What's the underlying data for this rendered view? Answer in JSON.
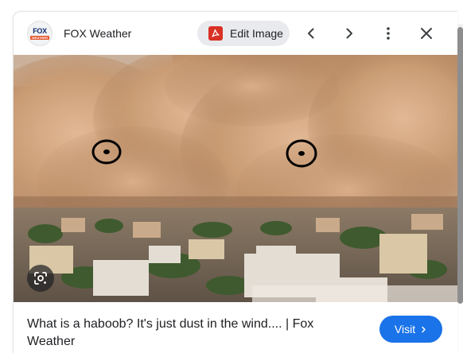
{
  "header": {
    "source_logo_top": "FOX",
    "source_logo_bottom": "WEATHER",
    "source_name": "FOX Weather",
    "edit_button_label": "Edit Image"
  },
  "icons": {
    "edit": "pdf-icon",
    "previous": "chevron-left-icon",
    "next": "chevron-right-icon",
    "more": "more-vert-icon",
    "close": "close-icon",
    "lens": "lens-icon",
    "visit": "chevron-right-icon"
  },
  "image": {
    "subject": "haboob"
  },
  "footer": {
    "title": "What is a haboob? It's just dust in the wind.... | Fox Weather",
    "visit_label": "Visit"
  },
  "colors": {
    "accent": "#1a73e8",
    "pdf_red": "#d93025",
    "text": "#202124"
  }
}
